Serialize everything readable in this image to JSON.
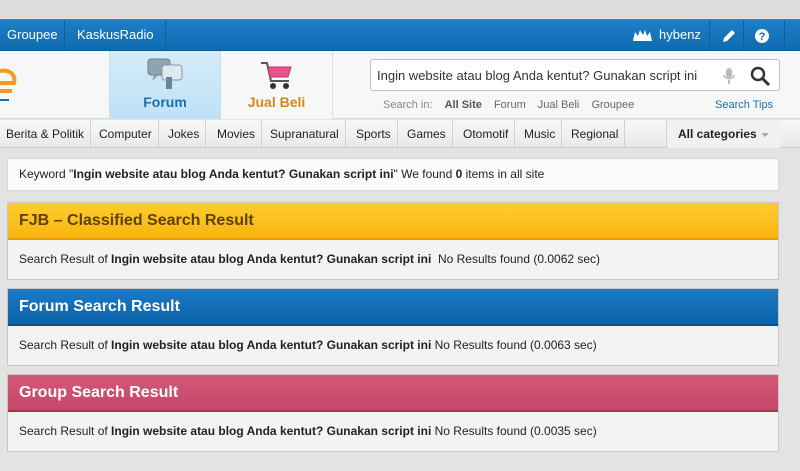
{
  "topnav": {
    "links": [
      "Groupee",
      "KaskusRadio"
    ],
    "username": "hybenz",
    "icons": [
      "user-icon",
      "edit-icon",
      "help-icon"
    ]
  },
  "header": {
    "tabs": [
      {
        "label": "Forum",
        "icon": "forum-chat-icon",
        "color": "#1a6fb3"
      },
      {
        "label": "Jual Beli",
        "icon": "shopping-cart-icon",
        "color": "#d9871a"
      }
    ],
    "search": {
      "value": "Ingin website atau blog Anda kentut? Gunakan script ini",
      "search_in_label": "Search in:",
      "scopes": [
        "All Site",
        "Forum",
        "Jual Beli",
        "Groupee"
      ],
      "active_scope": "All Site",
      "tips": "Search Tips"
    }
  },
  "categories": {
    "items": [
      "Berita & Politik",
      "Computer",
      "Jokes",
      "Movies",
      "Supranatural",
      "Sports",
      "Games",
      "Otomotif",
      "Music",
      "Regional"
    ],
    "all_label": "All categories"
  },
  "keyword_line": {
    "prefix": "Keyword \"",
    "keyword": "Ingin website atau blog Anda kentut? Gunakan script ini",
    "middle": "\" We found ",
    "count": "0",
    "suffix": " items in all site"
  },
  "panels": [
    {
      "title": "FJB – Classified Search Result",
      "prefix": "Search Result of ",
      "query": "Ingin website atau blog Anda kentut? Gunakan script ini",
      "status": "  No Results found (0.0062 sec)",
      "color": "#f9b40e"
    },
    {
      "title": "Forum Search Result",
      "prefix": "Search Result of ",
      "query": "Ingin website atau blog Anda kentut? Gunakan script ini",
      "status": " No Results found (0.0063 sec)",
      "color": "#0d63a8"
    },
    {
      "title": "Group Search Result",
      "prefix": "Search Result of ",
      "query": "Ingin website atau blog Anda kentut? Gunakan script ini",
      "status": " No Results found (0.0035 sec)",
      "color": "#c4466a"
    }
  ]
}
